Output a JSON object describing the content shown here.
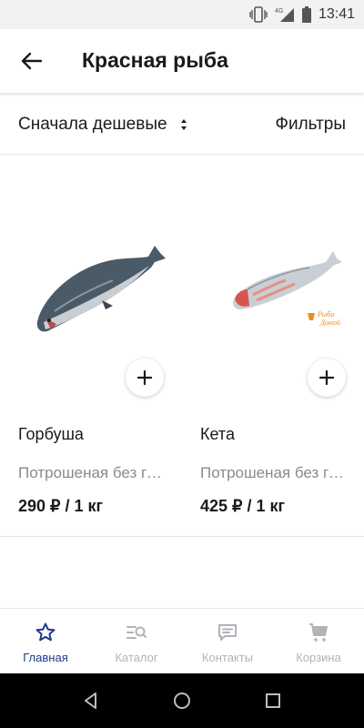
{
  "status_bar": {
    "time": "13:41",
    "network": "4G"
  },
  "header": {
    "title": "Красная рыба"
  },
  "toolbar": {
    "sort_label": "Сначала дешевые",
    "filters_label": "Фильтры"
  },
  "products": [
    {
      "name": "Горбуша",
      "description": "Потрошеная без головы",
      "price": "290 ₽ / 1 кг"
    },
    {
      "name": "Кета",
      "description": "Потрошеная без головы",
      "price": "425 ₽ / 1 кг",
      "watermark": "Рыба Домой"
    }
  ],
  "bottom_nav": {
    "items": [
      {
        "label": "Главная",
        "icon": "star-icon",
        "active": true
      },
      {
        "label": "Каталог",
        "icon": "catalog-search-icon",
        "active": false
      },
      {
        "label": "Контакты",
        "icon": "chat-icon",
        "active": false
      },
      {
        "label": "Корзина",
        "icon": "cart-icon",
        "active": false
      }
    ]
  },
  "colors": {
    "accent": "#1e3a8a",
    "inactive": "#b0b3b8",
    "secondary_text": "#8a8a8a"
  }
}
